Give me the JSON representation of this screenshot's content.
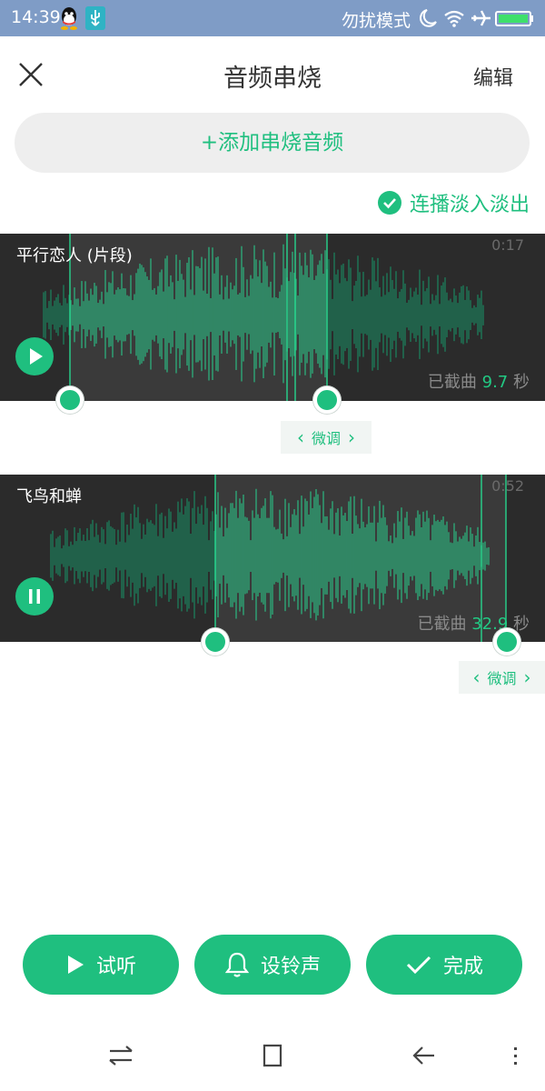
{
  "status_bar": {
    "time": "14:39",
    "mode": "勿扰模式",
    "icons": [
      "qq-icon",
      "usb-icon",
      "moon-icon",
      "wifi-icon",
      "airplane-icon",
      "battery-icon"
    ]
  },
  "header": {
    "title": "音频串烧",
    "edit_label": "编辑",
    "close_icon": "close-icon"
  },
  "add_button": {
    "label": "+添加串烧音频"
  },
  "crossfade": {
    "label": "连播淡入淡出",
    "checked": true
  },
  "tracks": [
    {
      "name": "平行恋人 (片段)",
      "duration": "0:17",
      "clip_prefix": "已截曲",
      "clip_value": "9.7",
      "clip_unit": "秒",
      "state": "paused",
      "button_icon": "play-icon"
    },
    {
      "name": "飞鸟和蝉",
      "duration": "0:52",
      "clip_prefix": "已截曲",
      "clip_value": "32.9",
      "clip_unit": "秒",
      "state": "playing",
      "button_icon": "pause-icon"
    }
  ],
  "fine_tune": {
    "label": "微调"
  },
  "actions": [
    {
      "label": "试听",
      "icon": "play-icon"
    },
    {
      "label": "设铃声",
      "icon": "bell-icon"
    },
    {
      "label": "完成",
      "icon": "check-icon"
    }
  ],
  "nav": {
    "icons": [
      "switch-icon",
      "home-icon",
      "back-icon",
      "menu-icon"
    ]
  },
  "colors": {
    "accent": "#1fbf7f",
    "track_bg": "#2b2b2b",
    "status_bar": "#7f9cc6"
  }
}
